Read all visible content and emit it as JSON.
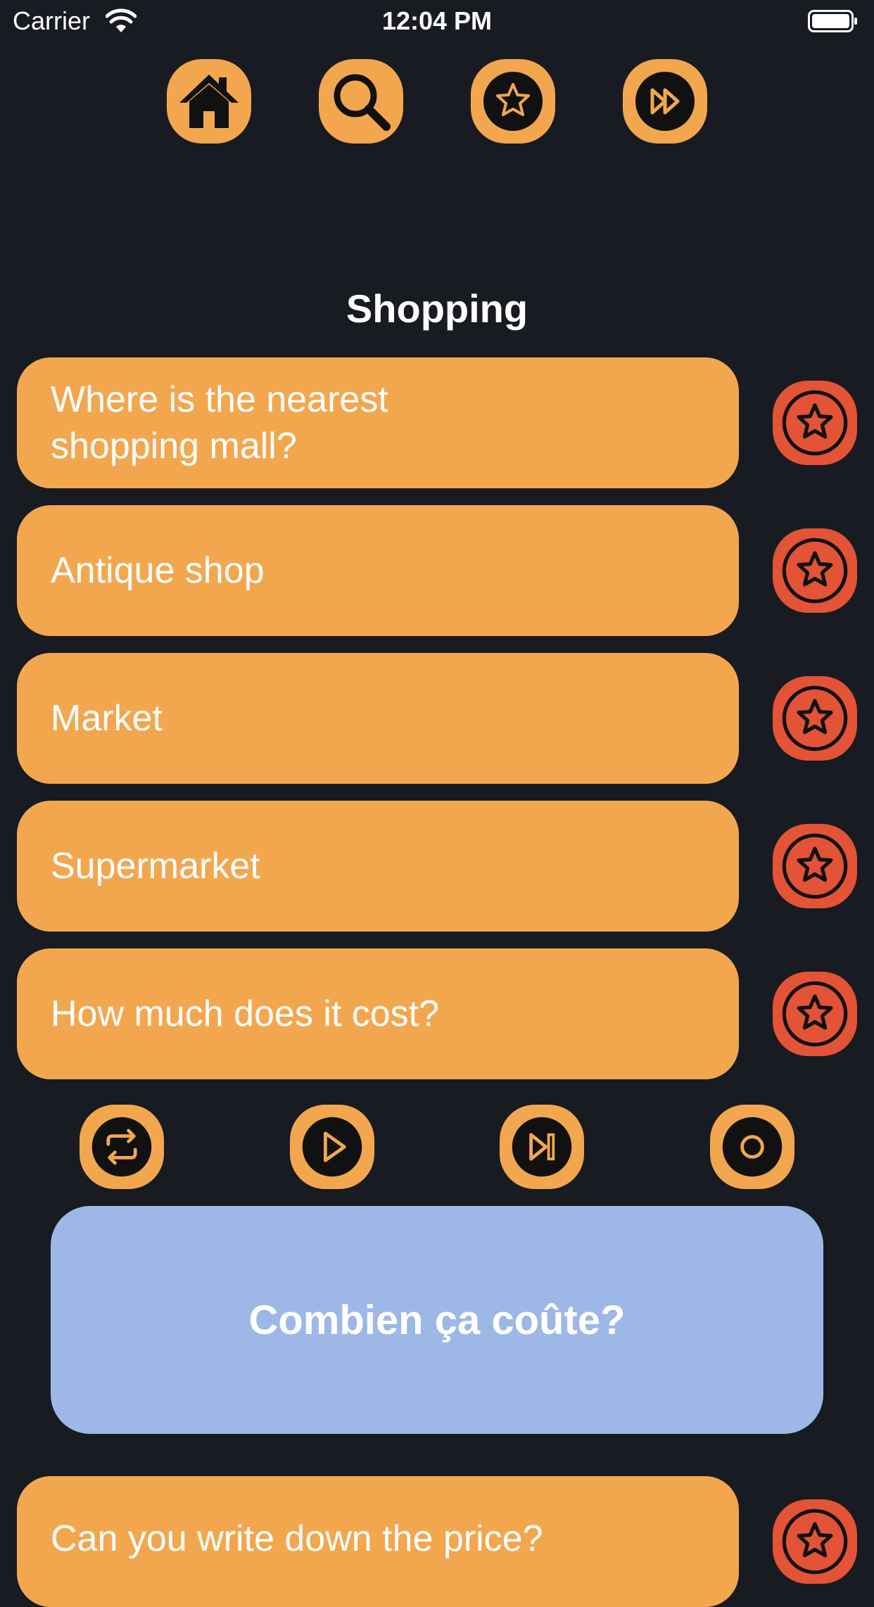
{
  "status_bar": {
    "carrier": "Carrier",
    "time": "12:04 PM"
  },
  "top_nav": [
    {
      "icon": "home-icon"
    },
    {
      "icon": "search-icon"
    },
    {
      "icon": "star-icon"
    },
    {
      "icon": "fast-forward-icon"
    }
  ],
  "section": {
    "title": "Shopping"
  },
  "phrases": [
    {
      "text": "Where is the nearest shopping mall?"
    },
    {
      "text": "Antique shop"
    },
    {
      "text": "Market"
    },
    {
      "text": "Supermarket"
    },
    {
      "text": "How much does it cost?"
    },
    {
      "text": "Can you write down the price?"
    }
  ],
  "controls": [
    {
      "icon": "repeat-icon"
    },
    {
      "icon": "play-icon"
    },
    {
      "icon": "skip-next-icon"
    },
    {
      "icon": "record-icon"
    }
  ],
  "translation": {
    "text": "Combien ça coûte?"
  },
  "colors": {
    "background": "#181b21",
    "accent_orange": "#f2a74f",
    "favorite_red": "#e35336",
    "translation_blue": "#9db8e6"
  }
}
